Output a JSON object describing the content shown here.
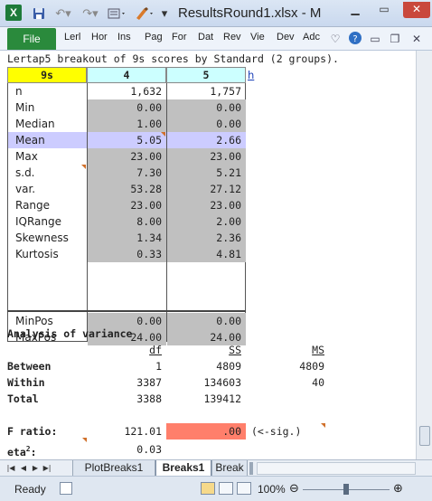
{
  "window": {
    "title": "ResultsRound1.xlsx  -  M",
    "excel_logo": "X"
  },
  "ribbon": {
    "file": "File",
    "tabs": [
      "Lerl",
      "Hor",
      "Ins",
      "Pag",
      "For",
      "Dat",
      "Rev",
      "Vie",
      "Dev",
      "Adc"
    ]
  },
  "sheet": {
    "heading": "Lertap5 breakout of 9s scores by Standard (2 groups).",
    "col_headers": [
      "9s",
      "4",
      "5",
      "h"
    ],
    "stats": [
      {
        "label": "n",
        "v1": "1,632",
        "v2": "1,757"
      },
      {
        "label": "Min",
        "v1": "0.00",
        "v2": "0.00"
      },
      {
        "label": "Median",
        "v1": "1.00",
        "v2": "0.00"
      },
      {
        "label": "Mean",
        "v1": "5.05",
        "v2": "2.66"
      },
      {
        "label": "Max",
        "v1": "23.00",
        "v2": "23.00"
      },
      {
        "label": "s.d.",
        "v1": "7.30",
        "v2": "5.21"
      },
      {
        "label": "var.",
        "v1": "53.28",
        "v2": "27.12"
      },
      {
        "label": "Range",
        "v1": "23.00",
        "v2": "23.00"
      },
      {
        "label": "IQRange",
        "v1": "8.00",
        "v2": "2.00"
      },
      {
        "label": "Skewness",
        "v1": "1.34",
        "v2": "2.36"
      },
      {
        "label": "Kurtosis",
        "v1": "0.33",
        "v2": "4.81"
      },
      {
        "label": "MinPos",
        "v1": "0.00",
        "v2": "0.00"
      },
      {
        "label": "MaxPos",
        "v1": "24.00",
        "v2": "24.00"
      }
    ],
    "anova": {
      "title": "Analysis of variance",
      "headers": [
        "df",
        "SS",
        "MS"
      ],
      "rows": [
        {
          "label": "Between",
          "df": "1",
          "ss": "4809",
          "ms": "4809"
        },
        {
          "label": "Within",
          "df": "3387",
          "ss": "134603",
          "ms": "40"
        },
        {
          "label": "Total",
          "df": "3388",
          "ss": "139412",
          "ms": ""
        }
      ],
      "f_label": "F ratio:",
      "f_value": "121.01",
      "p_value": ".00",
      "sig_note": "(<-sig.)",
      "eta_label": "eta",
      "eta_sup": "2",
      "eta_suffix": ":",
      "eta_value": "0.03"
    }
  },
  "sheet_tabs": [
    "PlotBreaks1",
    "Breaks1",
    "Break"
  ],
  "status": {
    "ready": "Ready",
    "zoom": "100%"
  },
  "colors": {
    "header_yellow": "#ffff00",
    "header_cyan": "#ccffff",
    "mean_highlight": "#ccccff",
    "gray_cell": "#c0c0c0",
    "pvalue_salmon": "#ff7f6b",
    "file_green": "#2a8a3c"
  }
}
